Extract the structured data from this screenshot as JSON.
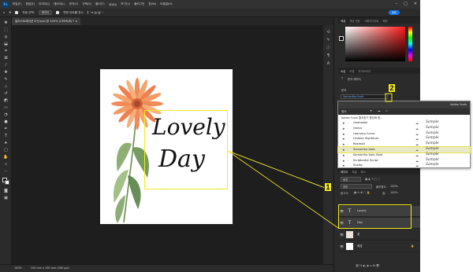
{
  "menu": {
    "logo": "Ps",
    "items": [
      "파일(F)",
      "편집(E)",
      "이미지(I)",
      "레이어(L)",
      "문자(Y)",
      "선택(S)",
      "필터(T)",
      "3D(D)",
      "보기(V)",
      "플러그인",
      "창(W)",
      "도움말(H)"
    ]
  },
  "options": {
    "auto_select": "자동 선택:",
    "layer_dropdown": "레이어",
    "transform_controls": "변형 컨트롤 표시",
    "share": "공유"
  },
  "document": {
    "tab_label": "일러스트레이션 도안.psd @ 100% (CMYK/8) *",
    "headline_line1": "Lovely",
    "headline_line2": "Day"
  },
  "status": {
    "zoom": "100%",
    "doc_info": "100 mm x 100 mm (300 ppi)"
  },
  "right_panel": {
    "color_tabs": [
      "색상",
      "색상 견본",
      "그레이디언트",
      "패턴"
    ],
    "properties_tabs": [
      "속성",
      "조정",
      "라이브러리"
    ],
    "text_layer_label": "문자 레이어",
    "char_section": "문자",
    "font_field": "Samantha Italic",
    "layers_tabs": [
      "레이어",
      "채널",
      "패스"
    ],
    "kind_filter": "종류",
    "blend_mode": "표준",
    "opacity_label": "불투명도:",
    "opacity_value": "100%",
    "lock_label": "잠그기:",
    "fill_label": "칠:",
    "fill_value": "100%",
    "layers": [
      {
        "name": "Lovely",
        "kind": "text"
      },
      {
        "name": "Day",
        "kind": "text"
      },
      {
        "name": "꽃",
        "kind": "image"
      },
      {
        "name": "배경",
        "kind": "background"
      }
    ]
  },
  "font_popup": {
    "title": "Adobe Fonts",
    "source_row": "Adobe Fonts 즐겨찾기 활성화 중...",
    "fonts": [
      {
        "name": "Geohoster",
        "sample": "Sample"
      },
      {
        "name": "Gelica",
        "sample": "Sample"
      },
      {
        "name": "Learning Curve",
        "sample": "Sample"
      },
      {
        "name": "Lindsey Signature",
        "sample": "Sample"
      },
      {
        "name": "Rexread",
        "sample": "Sample"
      },
      {
        "name": "Samantha Italic",
        "sample": "Sample",
        "selected": true
      },
      {
        "name": "Samantha Italic Bold",
        "sample": "Sample"
      },
      {
        "name": "Scriptorder Script",
        "sample": "Sample"
      },
      {
        "name": "Shelby",
        "sample": "Sample"
      }
    ]
  },
  "callouts": {
    "one": "1",
    "two": "2"
  },
  "colors": {
    "highlight": "#f2ea1e",
    "accent_blue": "#1473e6",
    "app_bg": "#1f1f1f",
    "panel_bg": "#2b2b2b"
  }
}
